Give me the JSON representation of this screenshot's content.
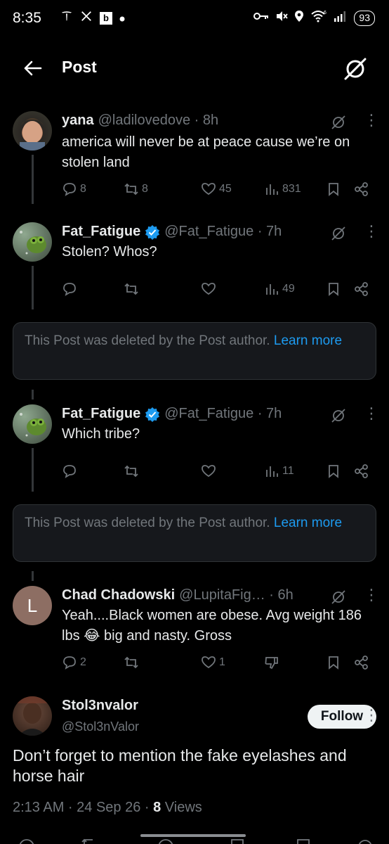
{
  "status_bar": {
    "time": "8:35",
    "left_icons": [
      "tesla-icon",
      "x-icon",
      "b-icon",
      "dot-icon"
    ],
    "right_icons": [
      "key-icon",
      "mute-icon",
      "location-icon",
      "wifi-icon",
      "signal-icon"
    ],
    "battery": "93"
  },
  "header": {
    "title": "Post"
  },
  "tweets": [
    {
      "name": "yana",
      "handle": "@ladilovedove · 8h",
      "text": "america will never be at peace cause we’re on stolen land",
      "replies": "8",
      "reposts": "8",
      "likes": "45",
      "views": "831",
      "verified": false
    },
    {
      "name": "Fat_Fatigue",
      "handle": "@Fat_Fatigue · 7h",
      "text": "Stolen?  Whos?",
      "replies": "",
      "reposts": "",
      "likes": "",
      "views": "49",
      "verified": true
    },
    {
      "name": "Fat_Fatigue",
      "handle": "@Fat_Fatigue · 7h",
      "text": "Which tribe?",
      "replies": "",
      "reposts": "",
      "likes": "",
      "views": "11",
      "verified": true
    },
    {
      "name": "Chad Chadowski",
      "handle": "@LupitaFig…  · 6h",
      "text": "Yeah....Black women are obese. Avg weight 186 lbs 😂  big and  nasty. Gross",
      "replies": "2",
      "reposts": "",
      "likes": "1",
      "views": "",
      "verified": false,
      "avatar_letter": "L"
    }
  ],
  "deleted_notice": {
    "text": "This Post was deleted by the Post author. ",
    "link": "Learn more"
  },
  "main_post": {
    "name": "Stol3nvalor",
    "handle": "@Stol3nValor",
    "follow_label": "Follow",
    "text": "Don’t forget to mention the fake eyelashes and horse hair",
    "time": "2:13 AM · 24 Sep 26 · ",
    "views_count": "8",
    "views_label": " Views"
  },
  "colors": {
    "accent": "#1d9bf0",
    "bg": "#000000",
    "muted": "#71767b"
  }
}
